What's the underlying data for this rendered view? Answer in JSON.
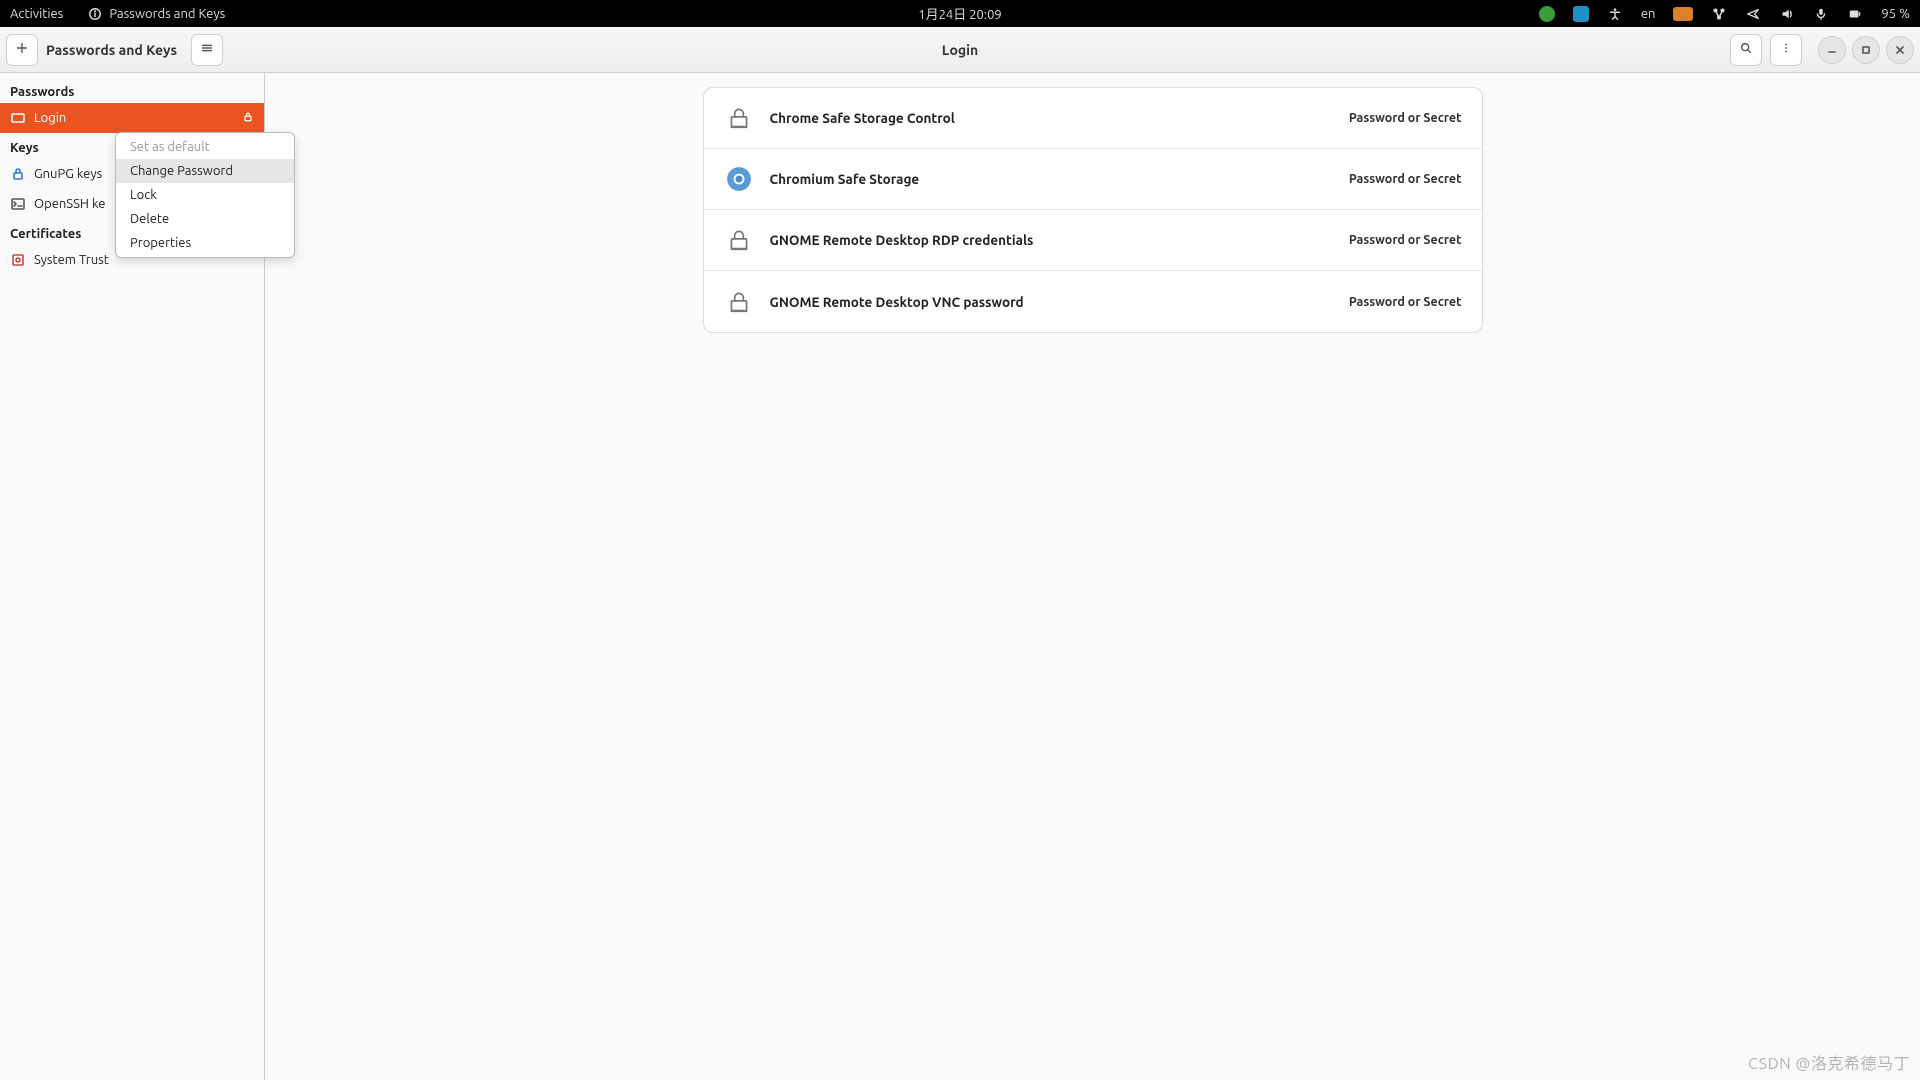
{
  "topbar": {
    "activities": "Activities",
    "app_indicator": "Passwords and Keys",
    "datetime": "1月24日  20:09",
    "lang": "en",
    "battery": "95 %"
  },
  "header": {
    "left_title": "Passwords and Keys",
    "center_title": "Login"
  },
  "sidebar": {
    "sections": [
      {
        "title": "Passwords",
        "items": [
          {
            "label": "Login",
            "icon": "keyring",
            "selected": true,
            "locked": true
          }
        ]
      },
      {
        "title": "Keys",
        "items": [
          {
            "label": "GnuPG keys",
            "icon": "gnupg"
          },
          {
            "label": "OpenSSH ke",
            "icon": "openssh"
          }
        ]
      },
      {
        "title": "Certificates",
        "items": [
          {
            "label": "System Trust",
            "icon": "cert"
          }
        ]
      }
    ]
  },
  "context_menu": {
    "items": [
      {
        "label": "Set as default",
        "disabled": true
      },
      {
        "label": "Change Password",
        "hover": true
      },
      {
        "label": "Lock"
      },
      {
        "label": "Delete"
      },
      {
        "label": "Properties"
      }
    ]
  },
  "passwords": {
    "type_label": "Password or Secret",
    "items": [
      {
        "name": "Chrome Safe Storage Control",
        "icon": "lock"
      },
      {
        "name": "Chromium Safe Storage",
        "icon": "chromium"
      },
      {
        "name": "GNOME Remote Desktop RDP credentials",
        "icon": "lock"
      },
      {
        "name": "GNOME Remote Desktop VNC password",
        "icon": "lock"
      }
    ]
  },
  "watermark": "CSDN @洛克希德马丁"
}
